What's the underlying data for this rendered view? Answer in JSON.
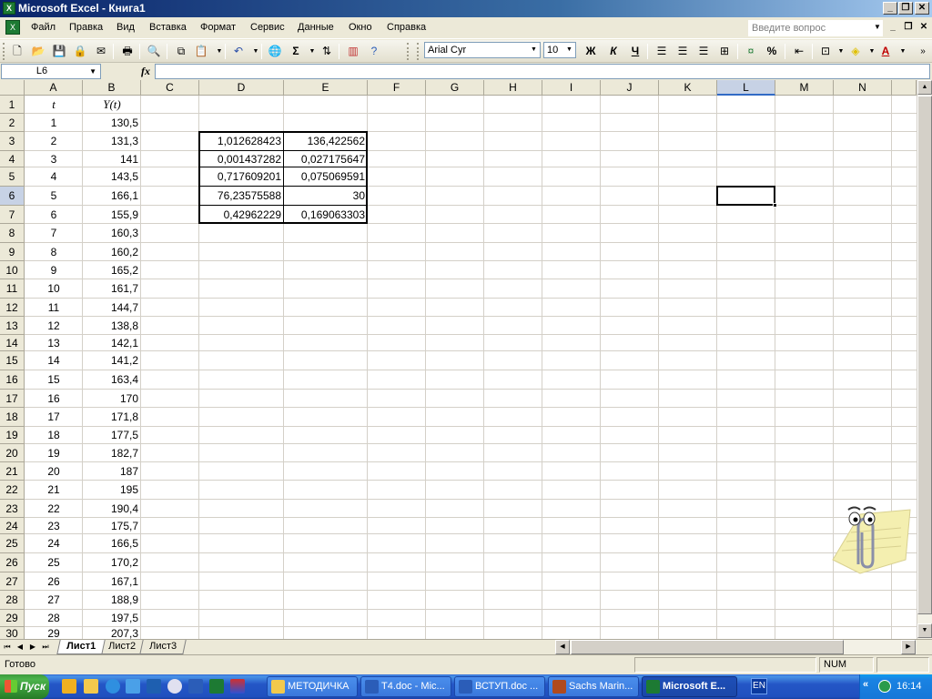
{
  "window": {
    "title": "Microsoft Excel - Книга1",
    "app_icon": "X",
    "buttons": [
      "minimize",
      "restore",
      "close"
    ]
  },
  "menu": {
    "items": [
      "Файл",
      "Правка",
      "Вид",
      "Вставка",
      "Формат",
      "Сервис",
      "Данные",
      "Окно",
      "Справка"
    ],
    "help_placeholder": "Введите вопрос"
  },
  "toolbar": {
    "font_name": "Arial Cyr",
    "font_size": "10",
    "bold": "Ж",
    "italic": "К",
    "underline": "Ч",
    "percent": "%",
    "sum": "Σ"
  },
  "formula_bar": {
    "name_box": "L6",
    "fx": "fx",
    "formula": ""
  },
  "grid": {
    "columns": [
      "A",
      "B",
      "C",
      "D",
      "E",
      "F",
      "G",
      "H",
      "I",
      "J",
      "K",
      "L",
      "M",
      "N"
    ],
    "rows": [
      "1",
      "2",
      "3",
      "4",
      "5",
      "6",
      "7",
      "8",
      "9",
      "10",
      "11",
      "12",
      "13",
      "14",
      "15",
      "16",
      "17",
      "18",
      "19",
      "20",
      "21",
      "22",
      "23",
      "24",
      "25",
      "26",
      "27",
      "28",
      "29",
      "30"
    ],
    "active_column": "L",
    "active_row": "6",
    "header": {
      "A": "t",
      "B": "Y(t)"
    },
    "data_rows": [
      {
        "t": "1",
        "y": "130,5"
      },
      {
        "t": "2",
        "y": "131,3"
      },
      {
        "t": "3",
        "y": "141"
      },
      {
        "t": "4",
        "y": "143,5"
      },
      {
        "t": "5",
        "y": "166,1"
      },
      {
        "t": "6",
        "y": "155,9"
      },
      {
        "t": "7",
        "y": "160,3"
      },
      {
        "t": "8",
        "y": "160,2"
      },
      {
        "t": "9",
        "y": "165,2"
      },
      {
        "t": "10",
        "y": "161,7"
      },
      {
        "t": "11",
        "y": "144,7"
      },
      {
        "t": "12",
        "y": "138,8"
      },
      {
        "t": "13",
        "y": "142,1"
      },
      {
        "t": "14",
        "y": "141,2"
      },
      {
        "t": "15",
        "y": "163,4"
      },
      {
        "t": "16",
        "y": "170"
      },
      {
        "t": "17",
        "y": "171,8"
      },
      {
        "t": "18",
        "y": "177,5"
      },
      {
        "t": "19",
        "y": "182,7"
      },
      {
        "t": "20",
        "y": "187"
      },
      {
        "t": "21",
        "y": "195"
      },
      {
        "t": "22",
        "y": "190,4"
      },
      {
        "t": "23",
        "y": "175,7"
      },
      {
        "t": "24",
        "y": "166,5"
      },
      {
        "t": "25",
        "y": "170,2"
      },
      {
        "t": "26",
        "y": "167,1"
      },
      {
        "t": "27",
        "y": "188,9"
      },
      {
        "t": "28",
        "y": "197,5"
      },
      {
        "t": "29",
        "y": "207,3"
      }
    ],
    "linest_block": [
      {
        "d": "1,012628423",
        "e": "136,422562"
      },
      {
        "d": "0,001437282",
        "e": "0,027175647"
      },
      {
        "d": "0,717609201",
        "e": "0,075069591"
      },
      {
        "d": "76,23575588",
        "e": "30"
      },
      {
        "d": "0,42962229",
        "e": "0,169063303"
      }
    ]
  },
  "sheets": {
    "tabs": [
      "Лист1",
      "Лист2",
      "Лист3"
    ],
    "active": "Лист1"
  },
  "status": {
    "text": "Готово",
    "num": "NUM"
  },
  "taskbar": {
    "start_label": "Пуск",
    "tasks": [
      {
        "label": "МЕТОДИЧКА",
        "icon_color": "#F2C94C",
        "active": false
      },
      {
        "label": "T4.doc - Mic...",
        "icon_color": "#2B5DB8",
        "active": false
      },
      {
        "label": "ВСТУП.doc ...",
        "icon_color": "#2B5DB8",
        "active": false
      },
      {
        "label": "Sachs Marin...",
        "icon_color": "#B04A1E",
        "active": false
      },
      {
        "label": "Microsoft E...",
        "icon_color": "#1D7A33",
        "active": true
      }
    ],
    "language": "EN",
    "clock": "16:14"
  }
}
